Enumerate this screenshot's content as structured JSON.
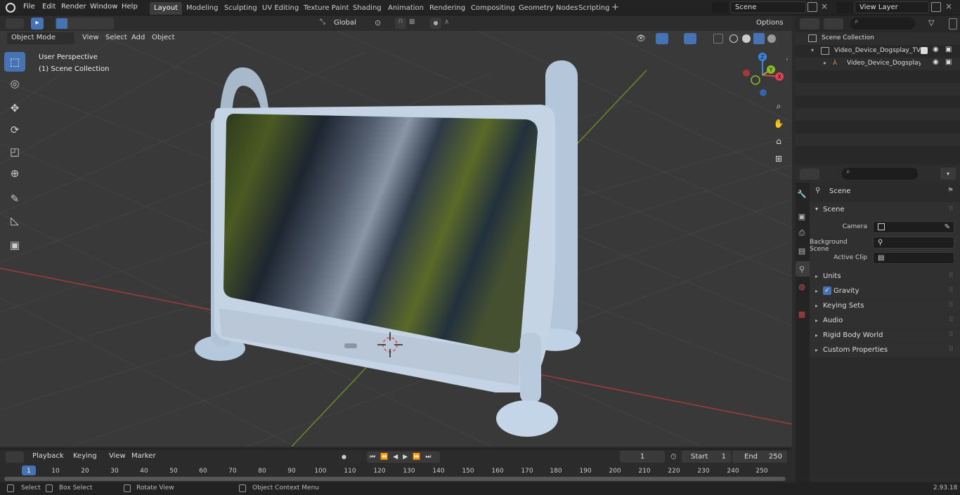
{
  "menu": {
    "file": "File",
    "edit": "Edit",
    "render": "Render",
    "window": "Window",
    "help": "Help"
  },
  "workspaces": [
    "Layout",
    "Modeling",
    "Sculpting",
    "UV Editing",
    "Texture Paint",
    "Shading",
    "Animation",
    "Rendering",
    "Compositing",
    "Geometry Nodes",
    "Scripting"
  ],
  "scene_field": "Scene",
  "view_layer_field": "View Layer",
  "header": {
    "transform_orientation": "Global",
    "options": "Options",
    "mode": "Object Mode",
    "view": "View",
    "select": "Select",
    "add": "Add",
    "object": "Object"
  },
  "viewport": {
    "perspective": "User Perspective",
    "collection": "(1) Scene Collection"
  },
  "gizmo": {
    "z": "Z",
    "y": "Y",
    "x": "X"
  },
  "outliner": {
    "root": "Scene Collection",
    "item1": "Video_Device_Dogsplay_TV_(",
    "item2": "Video_Device_Dogsplay_"
  },
  "properties": {
    "context": "Scene",
    "panel": "Scene",
    "camera_label": "Camera",
    "background_label": "Background Scene",
    "clip_label": "Active Clip",
    "sections": [
      "Units",
      "Gravity",
      "Keying Sets",
      "Audio",
      "Rigid Body World",
      "Custom Properties"
    ]
  },
  "timeline": {
    "playback": "Playback",
    "keying": "Keying",
    "view": "View",
    "marker": "Marker",
    "current_frame": "1",
    "start_label": "Start",
    "start": "1",
    "end_label": "End",
    "end": "250",
    "ticks": [
      "1",
      "10",
      "20",
      "30",
      "40",
      "50",
      "60",
      "70",
      "80",
      "90",
      "100",
      "110",
      "120",
      "130",
      "140",
      "150",
      "160",
      "170",
      "180",
      "190",
      "200",
      "210",
      "220",
      "230",
      "240",
      "250"
    ]
  },
  "status": {
    "select": "Select",
    "box_select": "Box Select",
    "rotate": "Rotate View",
    "context_menu": "Object Context Menu",
    "version": "2.93.18"
  },
  "colors": {
    "accent": "#4772b3",
    "x_axis": "#e0434f",
    "y_axis": "#8bbb2b",
    "z_axis": "#3d86e0"
  }
}
